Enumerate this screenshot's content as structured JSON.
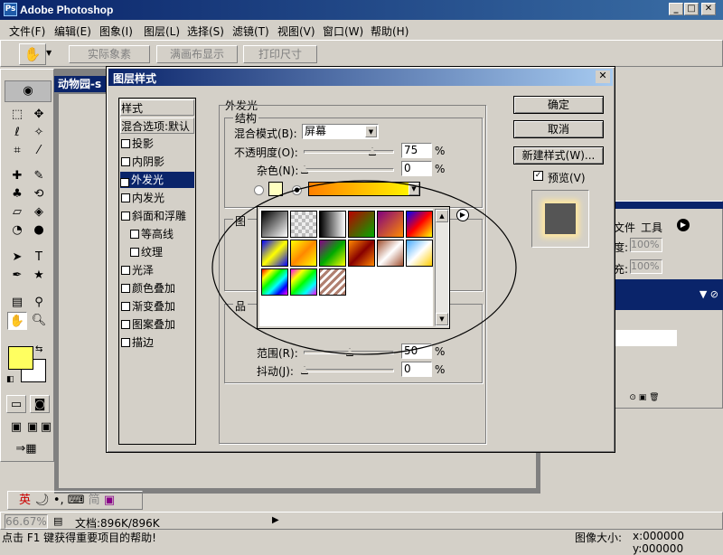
{
  "app": {
    "title": "Adobe Photoshop",
    "icon": "Ps"
  },
  "menu": [
    "文件(F)",
    "编辑(E)",
    "图象(I)",
    "图层(L)",
    "选择(S)",
    "滤镜(T)",
    "视图(V)",
    "窗口(W)",
    "帮助(H)"
  ],
  "options": {
    "tool_icon": "hand-tool-icon",
    "buttons": [
      "实际象素",
      "满画布显示",
      "打印尺寸"
    ]
  },
  "document": {
    "title_fragment": "动物园-s"
  },
  "layers_panel": {
    "tabs": [
      "文件",
      "工具"
    ],
    "opacity_label": "度:",
    "opacity_value": "100%",
    "fill_label": "充:",
    "fill_value": "100%"
  },
  "dialog": {
    "title": "图层样式",
    "styles_header": "样式",
    "blend_default": "混合选项:默认",
    "styles": [
      {
        "label": "投影",
        "checked": false,
        "indent": false
      },
      {
        "label": "内阴影",
        "checked": false,
        "indent": false
      },
      {
        "label": "外发光",
        "checked": true,
        "indent": false,
        "selected": true
      },
      {
        "label": "内发光",
        "checked": false,
        "indent": false
      },
      {
        "label": "斜面和浮雕",
        "checked": false,
        "indent": false
      },
      {
        "label": "等高线",
        "checked": false,
        "indent": true
      },
      {
        "label": "纹理",
        "checked": false,
        "indent": true
      },
      {
        "label": "光泽",
        "checked": false,
        "indent": false
      },
      {
        "label": "颜色叠加",
        "checked": false,
        "indent": false
      },
      {
        "label": "渐变叠加",
        "checked": false,
        "indent": false
      },
      {
        "label": "图案叠加",
        "checked": false,
        "indent": false
      },
      {
        "label": "描边",
        "checked": false,
        "indent": false
      }
    ],
    "section_title": "外发光",
    "structure_title": "结构",
    "blend_mode_label": "混合模式(B):",
    "blend_mode_value": "屏幕",
    "opacity_label": "不透明度(O):",
    "opacity_value": "75",
    "noise_label": "杂色(N):",
    "noise_value": "0",
    "percent": "%",
    "elements_title_partial": "图",
    "quality_title_partial": "品",
    "range_label": "范围(R):",
    "range_value": "50",
    "jitter_label": "抖动(J):",
    "jitter_value": "0",
    "buttons": {
      "ok": "确定",
      "cancel": "取消",
      "new_style": "新建样式(W)...",
      "preview": "预览(V)"
    },
    "preview_checked": true
  },
  "gradients": [
    "linear-gradient(135deg,#000,#fff)",
    "repeating-conic-gradient(#bbb 0 25%,#eee 0 50%) 0 0/8px 8px",
    "linear-gradient(90deg,#000,#fff)",
    "linear-gradient(135deg,#b00,#0a0)",
    "linear-gradient(135deg,#800080,#ff8c00)",
    "linear-gradient(135deg,#00f,#f00,#ff0)",
    "linear-gradient(135deg,#00f,#ff0,#00f)",
    "linear-gradient(135deg,#ff0,#f80,#ff0)",
    "linear-gradient(135deg,#808,#0a0,#ff0)",
    "linear-gradient(135deg,#f80,#800,#f80)",
    "linear-gradient(135deg,#a05030,#fff,#a05030)",
    "linear-gradient(135deg,#4af,#fff,#fc0)",
    "linear-gradient(135deg,#f00,#ff0,#0f0,#0ff,#00f,#f0f)",
    "linear-gradient(135deg,#f0f,#ff0,#0f0,#0ff,#f0f)",
    "repeating-linear-gradient(135deg,#b08070 0 3px,#fff 3px 6px)"
  ],
  "colors": {
    "foreground": "#ffff60",
    "background": "#ffffff",
    "titlebar": "#0a246a",
    "selection": "#0a246a"
  },
  "status": {
    "zoom": "66.67%",
    "doc_info": "文档:896K/896K",
    "hint": "点击 F1 键获得重要项目的帮助!",
    "image_size_label": "图像大小:",
    "coords": "x:000000 y:000000"
  },
  "taskbar": {
    "ime": "英"
  }
}
